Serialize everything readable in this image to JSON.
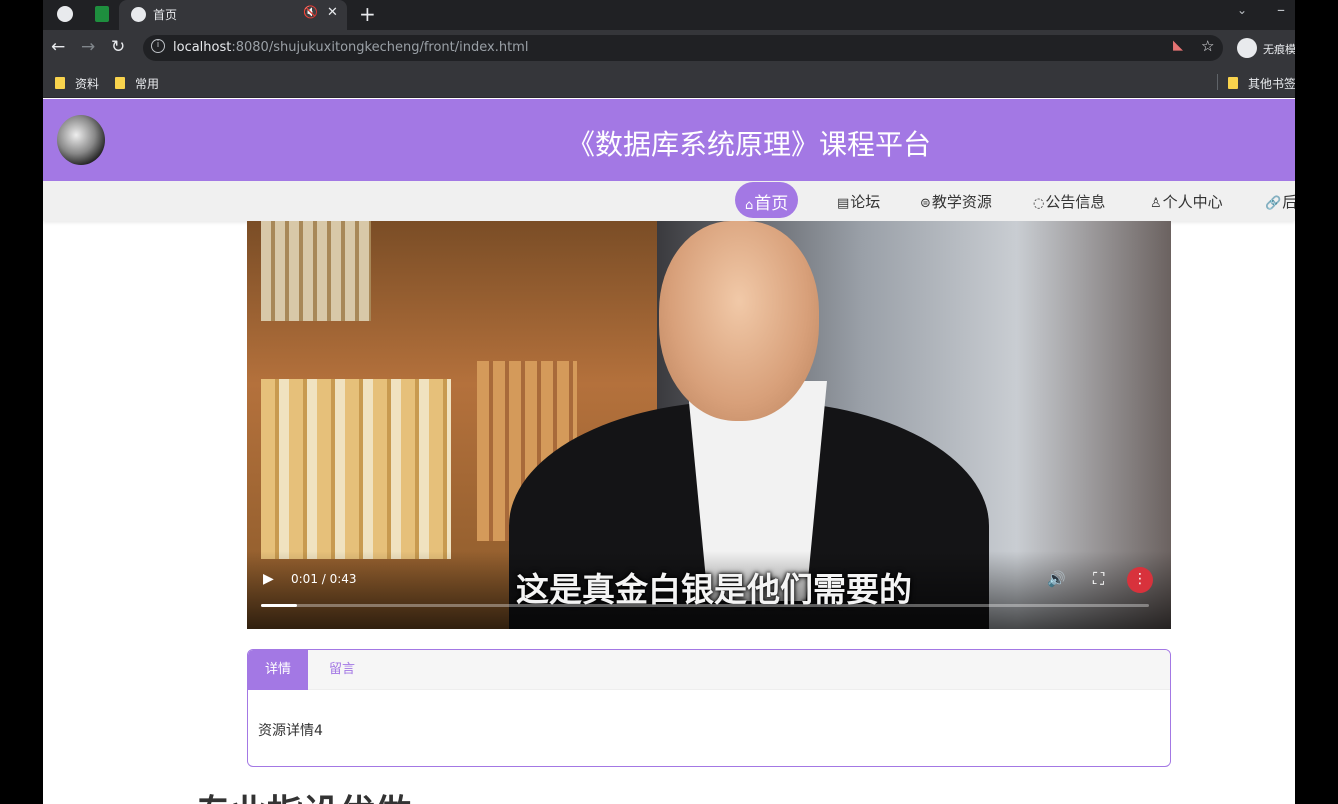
{
  "browser": {
    "active_tab_title": "首页",
    "url_host": "localhost",
    "url_rest": ":8080/shujukuxitongkecheng/front/index.html",
    "profile_label": "无痕模式",
    "bookmarks": [
      "资料",
      "常用"
    ],
    "other_bookmarks": "其他书签"
  },
  "header": {
    "site_title": "《数据库系统原理》课程平台"
  },
  "nav": {
    "items": [
      {
        "icon": "home-icon",
        "label": "首页"
      },
      {
        "icon": "forum-icon",
        "label": "论坛"
      },
      {
        "icon": "resource-icon",
        "label": "教学资源"
      },
      {
        "icon": "notice-icon",
        "label": "公告信息"
      },
      {
        "icon": "user-icon",
        "label": "个人中心"
      },
      {
        "icon": "link-icon",
        "label": "后"
      }
    ]
  },
  "video": {
    "subtitle": "这是真金白银是他们需要的",
    "time": "0:01 / 0:43",
    "progress": 0.04
  },
  "detail_tabs": {
    "tabs": [
      "详情",
      "留言"
    ],
    "active": 0,
    "body": "资源详情4"
  },
  "section": {
    "heading": "专业指设优做"
  },
  "colors": {
    "accent": "#a378e4"
  }
}
